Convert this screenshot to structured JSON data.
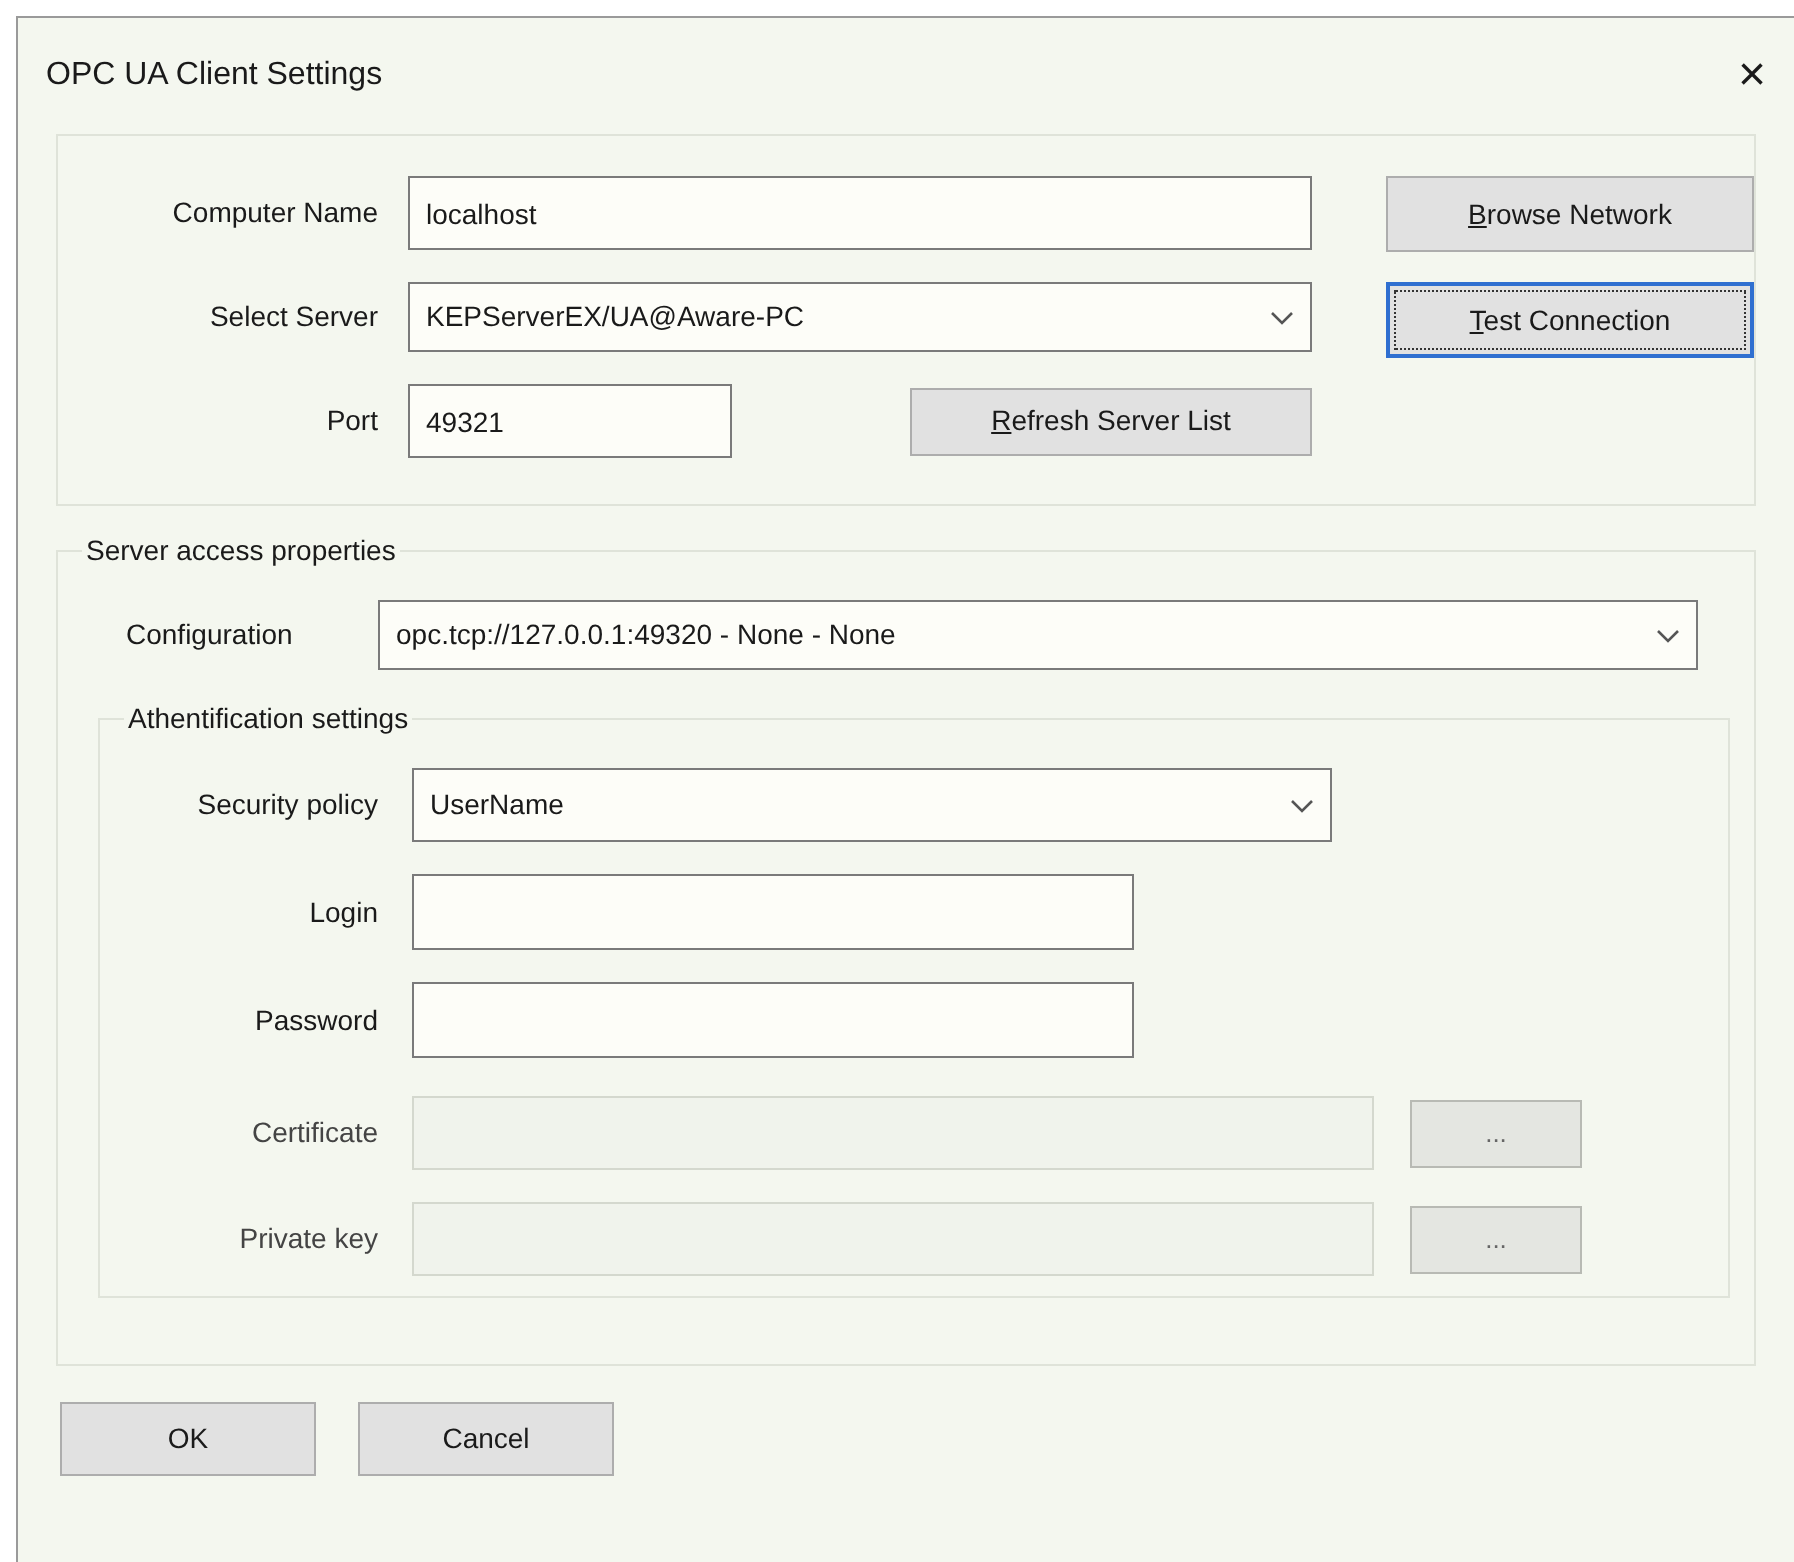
{
  "window": {
    "title": "OPC UA Client Settings",
    "close": "×"
  },
  "connection": {
    "fields": [
      {
        "kind": "text",
        "label": "Computer Name",
        "value": "localhost"
      },
      {
        "kind": "dropdown",
        "label": "Select Server",
        "value": "KEPServerEX/UA@Aware-PC"
      },
      {
        "kind": "text",
        "label": "Port",
        "value": "49321"
      }
    ],
    "buttons": [
      {
        "label": "Browse Network",
        "underline_first": true,
        "focused": false
      },
      {
        "label": "Test Connection",
        "underline_first": true,
        "focused": true
      },
      {
        "label": "Refresh Server List",
        "underline_first": true,
        "focused": false
      }
    ]
  },
  "server_access": {
    "title": "Server access properties",
    "configuration": {
      "label": "Configuration",
      "value": "opc.tcp://127.0.0.1:49320 - None - None"
    },
    "authentication": {
      "title": "Athentification settings",
      "fields": [
        {
          "kind": "dropdown",
          "label": "Security policy",
          "value": "UserName",
          "disabled": false
        },
        {
          "kind": "text",
          "label": "Login",
          "disabled": false
        },
        {
          "kind": "text",
          "label": "Password",
          "disabled": false
        },
        {
          "kind": "file",
          "label": "Certificate",
          "disabled": true,
          "button": "..."
        },
        {
          "kind": "file",
          "label": "Private key",
          "disabled": true,
          "button": "..."
        }
      ]
    }
  },
  "buttons": [
    {
      "label": "OK"
    },
    {
      "label": "Cancel"
    }
  ]
}
